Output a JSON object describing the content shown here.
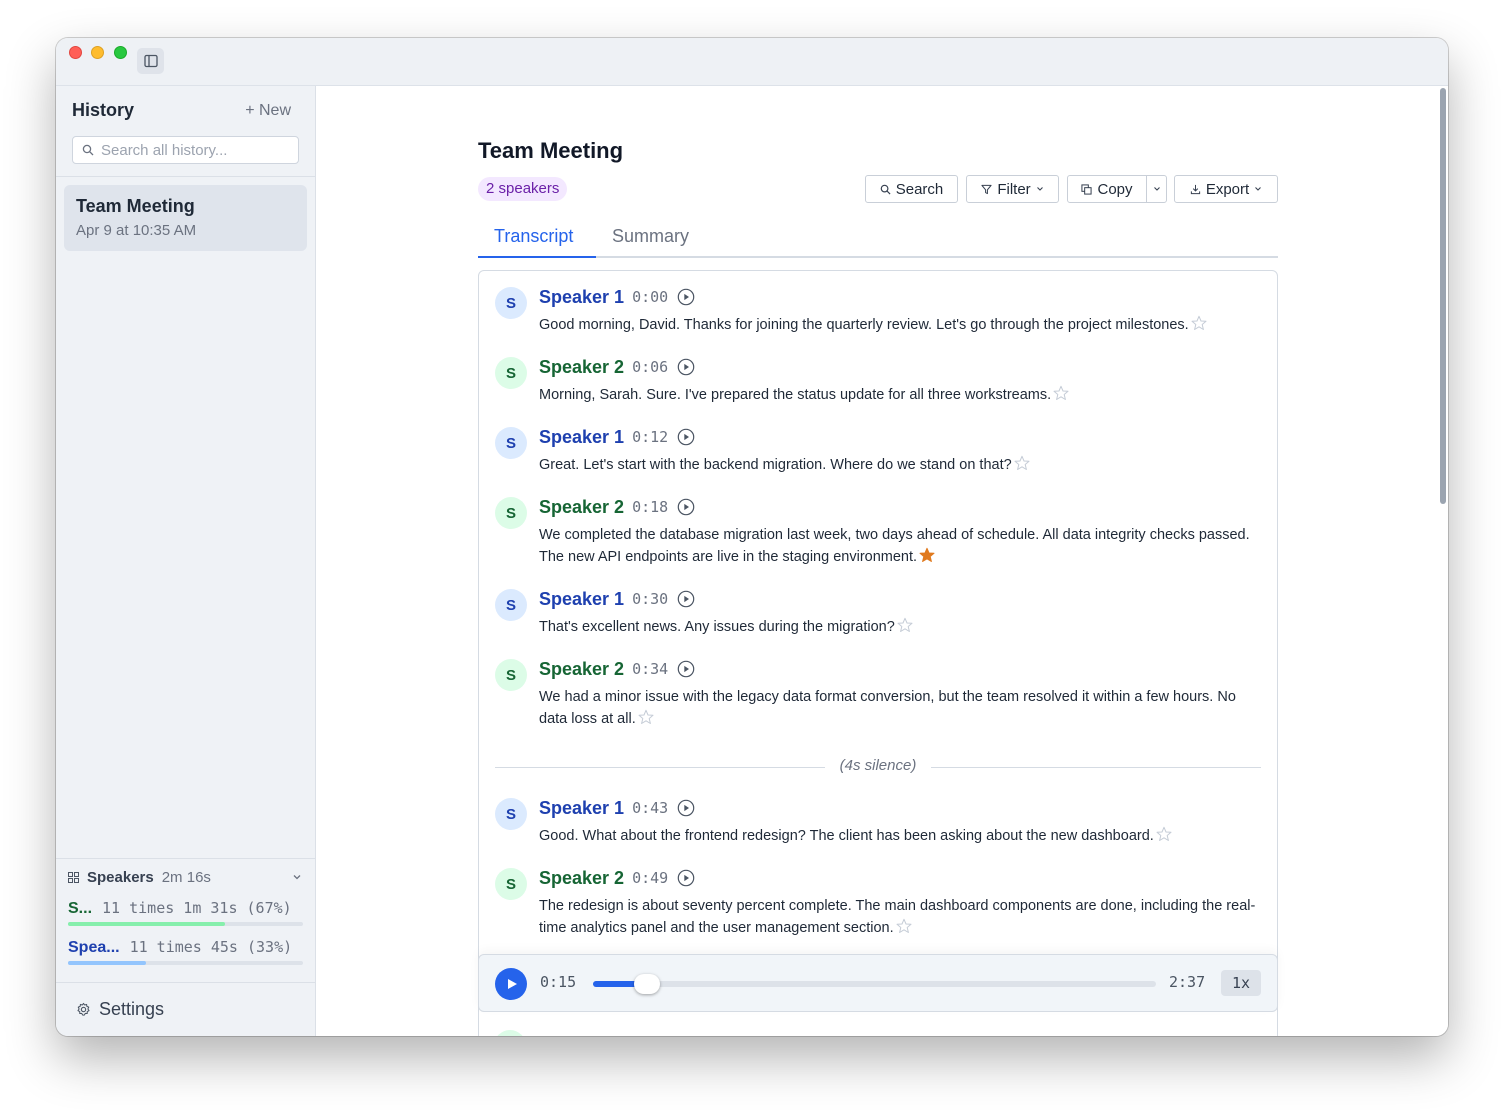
{
  "sidebar": {
    "title": "History",
    "new_label": "+ New",
    "search_placeholder": "Search all history...",
    "history": [
      {
        "title": "Team Meeting",
        "date": "Apr 9 at 10:35 AM"
      }
    ],
    "speakers_panel": {
      "label": "Speakers",
      "duration": "2m 16s",
      "rows": [
        {
          "name": "S...",
          "stats": "11 times 1m 31s (67%)",
          "share": 0.67,
          "color": "#86efac",
          "name_color": "#166534"
        },
        {
          "name": "Spea...",
          "stats": "11 times 45s (33%)",
          "share": 0.33,
          "color": "#93c5fd",
          "name_color": "#1e40af"
        }
      ]
    },
    "settings_label": "Settings"
  },
  "main": {
    "title": "Team Meeting",
    "speakers_badge": "2 speakers",
    "toolbar": {
      "search": "Search",
      "filter": "Filter",
      "copy": "Copy",
      "export": "Export"
    },
    "tabs": [
      "Transcript",
      "Summary"
    ],
    "utterances": [
      {
        "speaker": "Speaker 1",
        "avatar": "S",
        "time": "0:00",
        "text": "Good morning, David. Thanks for joining the quarterly review. Let's go through the project milestones.",
        "starred": false
      },
      {
        "speaker": "Speaker 2",
        "avatar": "S",
        "time": "0:06",
        "text": "Morning, Sarah. Sure. I've prepared the status update for all three workstreams.",
        "starred": false
      },
      {
        "speaker": "Speaker 1",
        "avatar": "S",
        "time": "0:12",
        "text": "Great. Let's start with the backend migration. Where do we stand on that?",
        "starred": false
      },
      {
        "speaker": "Speaker 2",
        "avatar": "S",
        "time": "0:18",
        "text": "We completed the database migration last week, two days ahead of schedule. All data integrity checks passed. The new API endpoints are live in the staging environment.",
        "starred": true
      },
      {
        "speaker": "Speaker 1",
        "avatar": "S",
        "time": "0:30",
        "text": "That's excellent news. Any issues during the migration?",
        "starred": false
      },
      {
        "speaker": "Speaker 2",
        "avatar": "S",
        "time": "0:34",
        "text": "We had a minor issue with the legacy data format conversion, but the team resolved it within a few hours. No data loss at all.",
        "starred": false
      },
      {
        "speaker": "Speaker 1",
        "avatar": "S",
        "time": "0:43",
        "text": "Good. What about the frontend redesign? The client has been asking about the new dashboard.",
        "starred": false
      },
      {
        "speaker": "Speaker 2",
        "avatar": "S",
        "time": "0:49",
        "text": "The redesign is about seventy percent complete. The main dashboard components are done, including the real-time analytics panel and the user management section.",
        "starred": false
      }
    ],
    "silence_label": "(4s silence)",
    "player": {
      "current": "0:15",
      "total": "2:37",
      "progress": 0.096,
      "speed": "1x"
    }
  }
}
